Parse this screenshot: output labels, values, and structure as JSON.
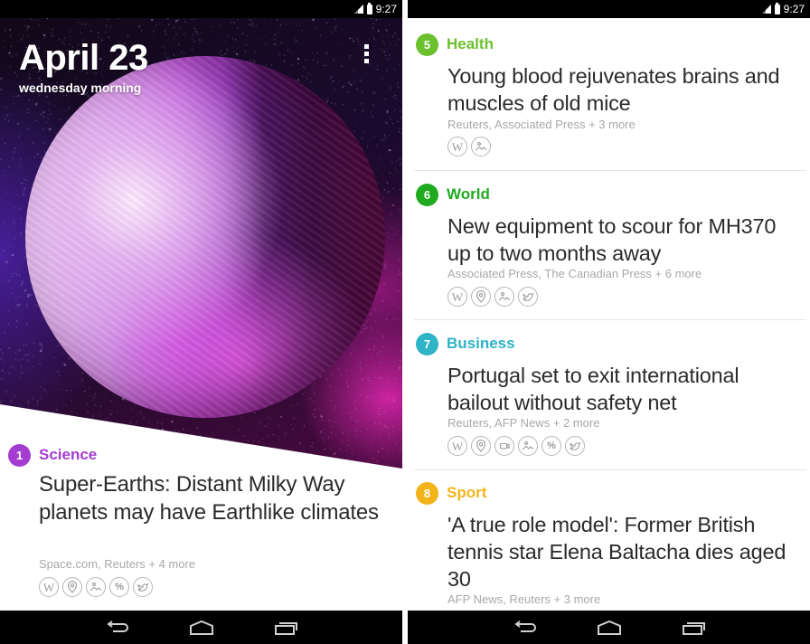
{
  "status_bar": {
    "time": "9:27",
    "signal_icon": "signal-icon",
    "battery_icon": "battery-icon"
  },
  "left_screen": {
    "hero": {
      "date": "April 23",
      "subtitle": "wednesday morning",
      "menu_icon": "overflow-menu-icon"
    },
    "story": {
      "number": "1",
      "category": "Science",
      "color": "#a43cd1",
      "headline": "Super-Earths: Distant Milky Way planets may have Earthlike climates",
      "sources": "Space.com, Reuters + 4 more",
      "icons": [
        "wikipedia-icon",
        "location-icon",
        "image-icon",
        "percent-icon",
        "twitter-icon"
      ]
    }
  },
  "right_screen": {
    "stories": [
      {
        "number": "5",
        "category": "Health",
        "color": "#6cc02e",
        "headline": "Young blood rejuvenates brains and muscles of old mice",
        "sources": "Reuters, Associated Press + 3 more",
        "icons": [
          "wikipedia-icon",
          "image-icon"
        ]
      },
      {
        "number": "6",
        "category": "World",
        "color": "#1faa1f",
        "headline": "New equipment to scour for MH370 up to two months away",
        "sources": "Associated Press, The Canadian Press + 6 more",
        "icons": [
          "wikipedia-icon",
          "location-icon",
          "image-icon",
          "twitter-icon"
        ]
      },
      {
        "number": "7",
        "category": "Business",
        "color": "#2fb3c6",
        "headline": "Portugal set to exit international bailout without safety net",
        "sources": "Reuters, AFP News + 2 more",
        "icons": [
          "wikipedia-icon",
          "location-icon",
          "video-icon",
          "image-icon",
          "percent-icon",
          "twitter-icon"
        ]
      },
      {
        "number": "8",
        "category": "Sport",
        "color": "#f2b418",
        "headline": "'A true role model': Former British tennis star Elena Baltacha dies aged 30",
        "sources": "AFP News, Reuters + 3 more",
        "icons": []
      }
    ]
  },
  "nav_bar": {
    "buttons": [
      "back-icon",
      "home-icon",
      "recents-icon"
    ]
  }
}
